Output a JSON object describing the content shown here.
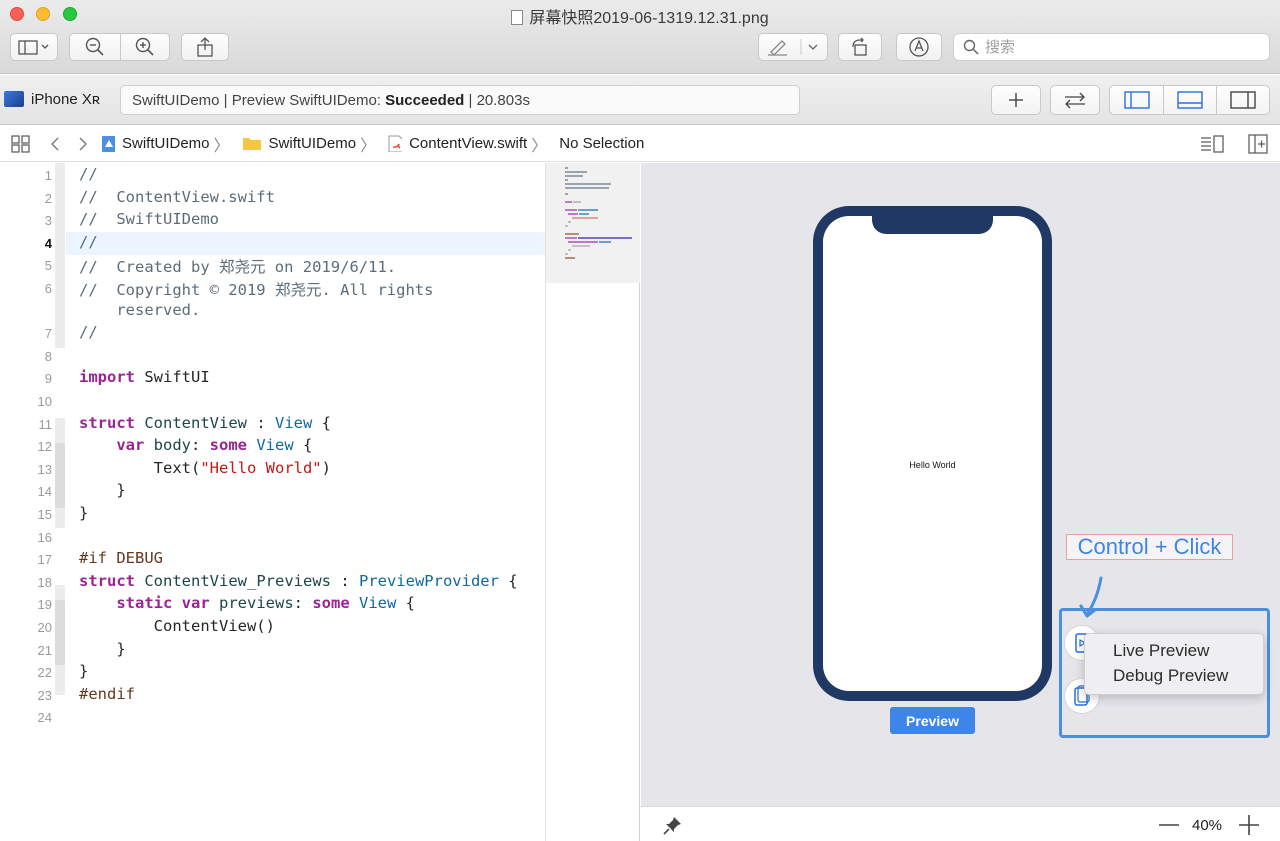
{
  "window": {
    "title": "屏幕快照2019-06-1319.12.31.png",
    "search_placeholder": "搜索"
  },
  "xcode_toolbar": {
    "device": "iPhone Xʀ",
    "activity_prefix": "SwiftUIDemo | Preview SwiftUIDemo: ",
    "activity_status": "Succeeded",
    "activity_suffix": " | 20.803s"
  },
  "jumpbar": {
    "items": [
      "SwiftUIDemo",
      "SwiftUIDemo",
      "ContentView.swift",
      "No Selection"
    ]
  },
  "editor": {
    "current_line": 4,
    "lines": [
      {
        "n": "1",
        "text": "//"
      },
      {
        "n": "2",
        "text": "//  ContentView.swift"
      },
      {
        "n": "3",
        "text": "//  SwiftUIDemo"
      },
      {
        "n": "4",
        "text": "//"
      },
      {
        "n": "5",
        "text": "//  Created by 郑尧元 on 2019/6/11."
      },
      {
        "n": "6",
        "text": "//  Copyright © 2019 郑尧元. All rights"
      },
      {
        "n": "",
        "text": "    reserved."
      },
      {
        "n": "7",
        "text": "//"
      },
      {
        "n": "8",
        "text": ""
      },
      {
        "n": "9",
        "text": "import SwiftUI"
      },
      {
        "n": "10",
        "text": ""
      },
      {
        "n": "11",
        "text": "struct ContentView : View {"
      },
      {
        "n": "12",
        "text": "    var body: some View {"
      },
      {
        "n": "13",
        "text": "        Text(\"Hello World\")"
      },
      {
        "n": "14",
        "text": "    }"
      },
      {
        "n": "15",
        "text": "}"
      },
      {
        "n": "16",
        "text": ""
      },
      {
        "n": "17",
        "text": "#if DEBUG"
      },
      {
        "n": "18",
        "text": "struct ContentView_Previews : PreviewProvider {"
      },
      {
        "n": "19",
        "text": "    static var previews: some View {"
      },
      {
        "n": "20",
        "text": "        ContentView()"
      },
      {
        "n": "21",
        "text": "    }"
      },
      {
        "n": "22",
        "text": "}"
      },
      {
        "n": "23",
        "text": "#endif"
      },
      {
        "n": "24",
        "text": ""
      }
    ]
  },
  "canvas": {
    "hello_text": "Hello World",
    "preview_label": "Preview",
    "annotation": "Control + Click",
    "menu_items": [
      "Live Preview",
      "Debug Preview"
    ],
    "zoom": "40%"
  },
  "colors": {
    "phone_frame": "#1f3864",
    "accent": "#3d85e8"
  }
}
